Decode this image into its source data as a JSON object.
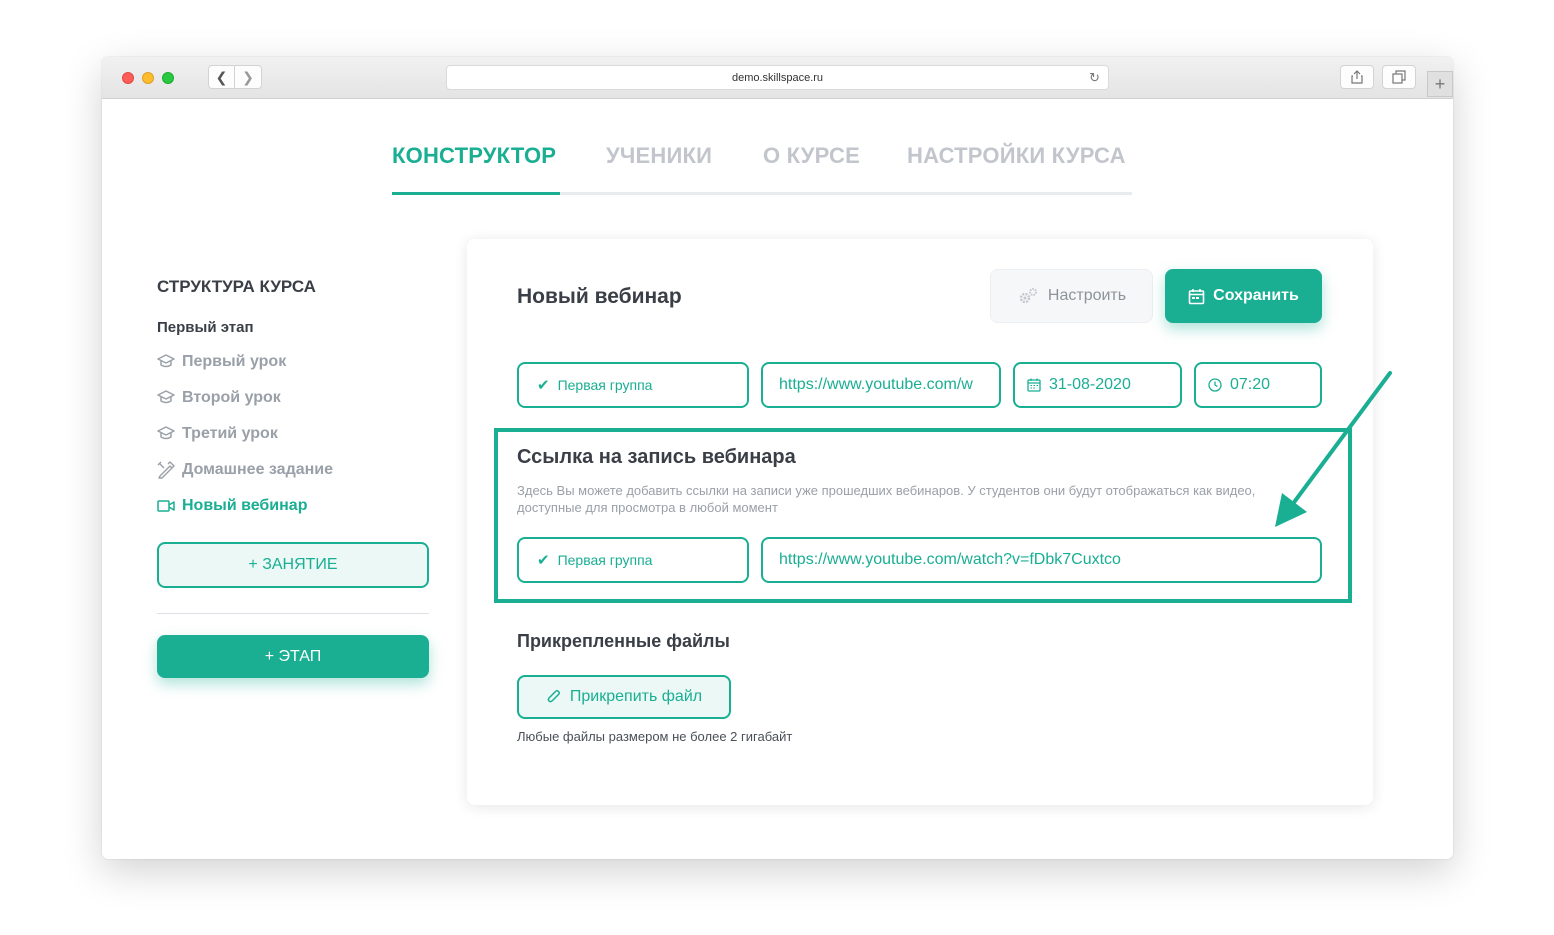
{
  "browser": {
    "url": "demo.skillspace.ru"
  },
  "tabs": [
    {
      "label": "КОНСТРУКТОР",
      "active": true
    },
    {
      "label": "УЧЕНИКИ",
      "active": false
    },
    {
      "label": "О КУРСЕ",
      "active": false
    },
    {
      "label": "НАСТРОЙКИ КУРСА",
      "active": false
    }
  ],
  "sidebar": {
    "title": "СТРУКТУРА КУРСА",
    "stage": "Первый этап",
    "items": [
      {
        "label": "Первый урок",
        "icon": "graduation-cap-icon"
      },
      {
        "label": "Второй урок",
        "icon": "graduation-cap-icon"
      },
      {
        "label": "Третий урок",
        "icon": "graduation-cap-icon"
      },
      {
        "label": "Домашнее задание",
        "icon": "homework-icon"
      },
      {
        "label": "Новый вебинар",
        "icon": "video-camera-icon",
        "active": true
      }
    ],
    "add_lesson": "+ ЗАНЯТИЕ",
    "add_stage": "+ ЭТАП"
  },
  "card": {
    "title": "Новый вебинар",
    "configure": "Настроить",
    "save": "Сохранить",
    "group": "Первая группа",
    "stream_url": "https://www.youtube.com/w",
    "date": "31-08-2020",
    "time": "07:20",
    "recording": {
      "title": "Ссылка на запись вебинара",
      "description": "Здесь Вы можете добавить ссылки на записи уже прошедших вебинаров. У студентов они будут отображаться как видео, доступные для просмотра в любой момент",
      "group": "Первая группа",
      "url": "https://www.youtube.com/watch?v=fDbk7Cuxtco"
    },
    "files": {
      "title": "Прикрепленные файлы",
      "attach": "Прикрепить файл",
      "hint": "Любые файлы размером не более 2 гигабайт"
    }
  },
  "colors": {
    "accent": "#1aae93",
    "muted": "#9aa0a8",
    "text": "#3a3f47"
  }
}
